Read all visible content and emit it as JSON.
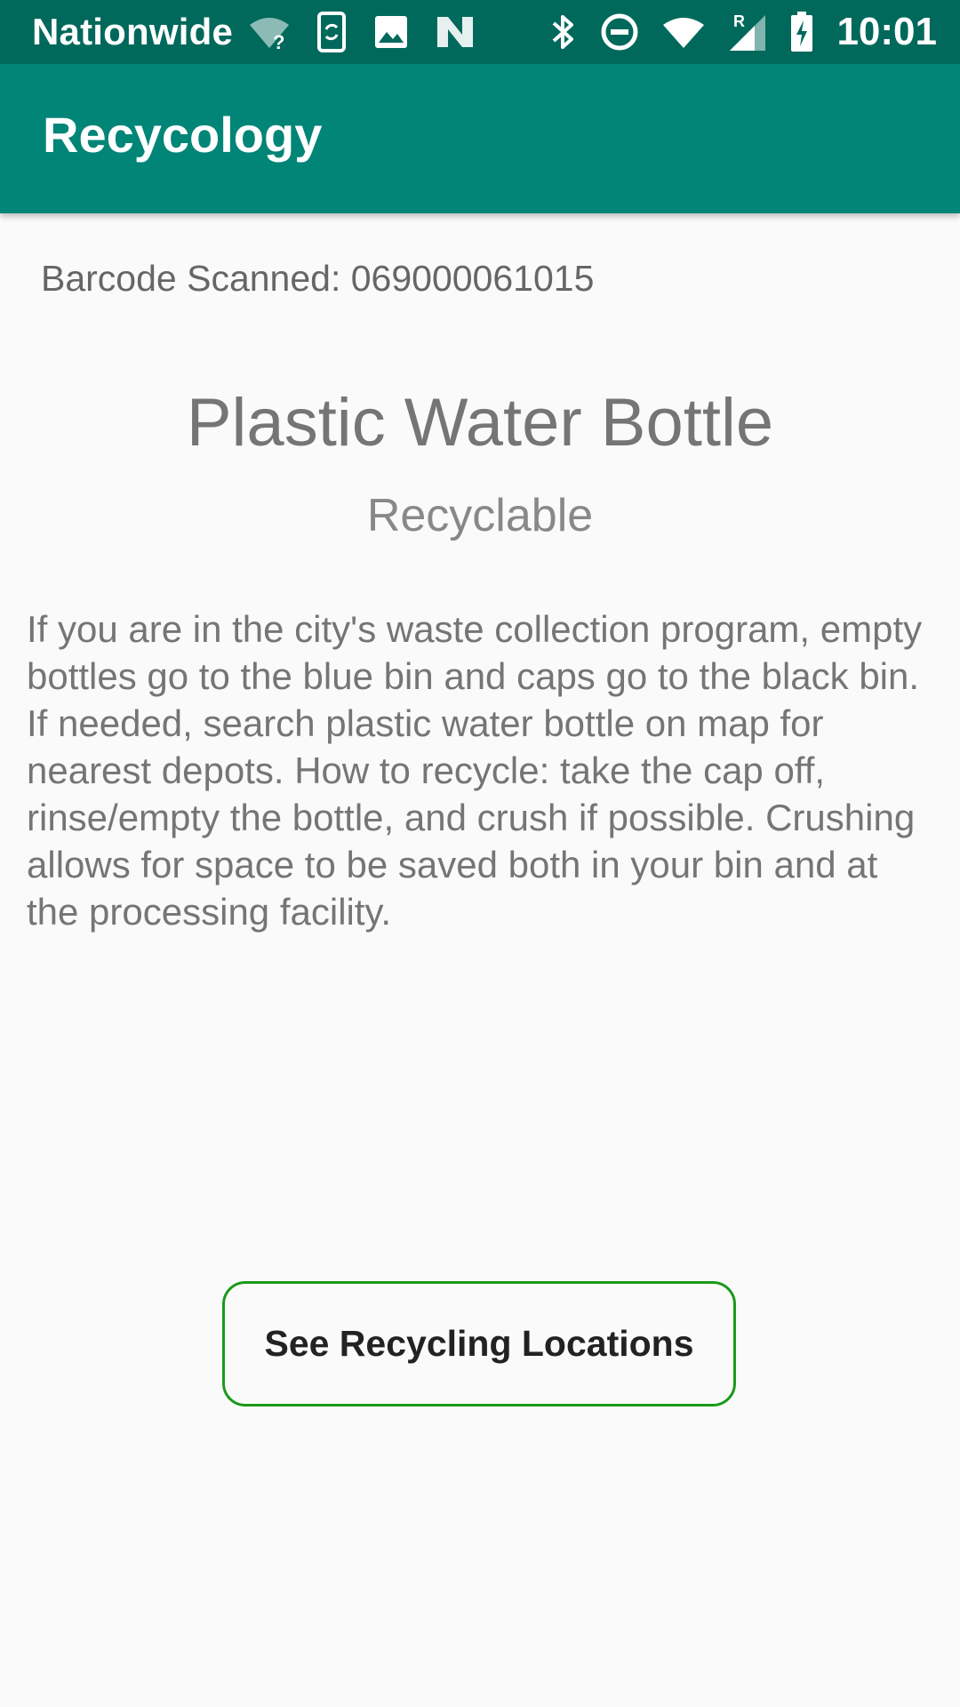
{
  "status_bar": {
    "carrier": "Nationwide",
    "time": "10:01",
    "icons": [
      "wifi-unknown-icon",
      "phone-sync-icon",
      "image-icon",
      "n-logo-icon",
      "bluetooth-icon",
      "do-not-disturb-icon",
      "wifi-icon",
      "cell-signal-icon",
      "battery-charging-icon"
    ]
  },
  "app_bar": {
    "title": "Recycology"
  },
  "scan": {
    "barcode_text": "Barcode Scanned: 069000061015"
  },
  "product": {
    "name": "Plastic Water Bottle",
    "status": "Recyclable",
    "description": "If you are in the city's waste collection program, empty bottles go to the blue bin and caps go to the black bin. If needed, search plastic water bottle on map for nearest depots. How to recycle: take the cap off, rinse/empty the bottle, and crush if possible. Crushing allows for space to be saved both in your bin and at the processing facility."
  },
  "actions": {
    "locations_button_label": "See Recycling Locations"
  },
  "colors": {
    "status_bar": "#00695c",
    "app_bar": "#008577",
    "button_border": "#1a9a1a",
    "background": "#fafafa"
  }
}
